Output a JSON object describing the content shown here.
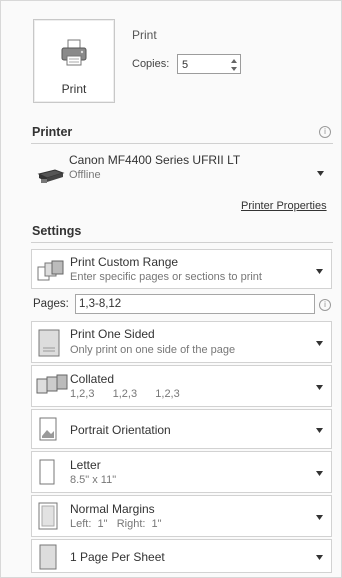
{
  "print_section": {
    "title": "Print",
    "print_button_label": "Print",
    "copies_label": "Copies:",
    "copies_value": "5"
  },
  "printer": {
    "section_title": "Printer",
    "name": "Canon MF4400 Series UFRII LT",
    "status": "Offline",
    "properties_link": "Printer Properties"
  },
  "settings": {
    "section_title": "Settings",
    "pages_label": "Pages:",
    "pages_value": "1,3-8,12",
    "options": [
      {
        "main": "Print Custom Range",
        "sub": "Enter specific pages or sections to print"
      },
      {
        "main": "Print One Sided",
        "sub": "Only print on one side of the page"
      },
      {
        "main": "Collated",
        "sub": "1,2,3   1,2,3   1,2,3"
      },
      {
        "main": "Portrait Orientation",
        "sub": ""
      },
      {
        "main": "Letter",
        "sub": "8.5\" x 11\""
      },
      {
        "main": "Normal Margins",
        "sub": "Left:  1\"   Right:  1\""
      },
      {
        "main": "1 Page Per Sheet",
        "sub": ""
      }
    ]
  },
  "icons": {
    "info": "info-icon",
    "caret": "chevron-down-icon",
    "printer": "printer-icon"
  },
  "colors": {
    "link": "#333333",
    "border": "#d2d2d2",
    "background": "#fafafa"
  }
}
